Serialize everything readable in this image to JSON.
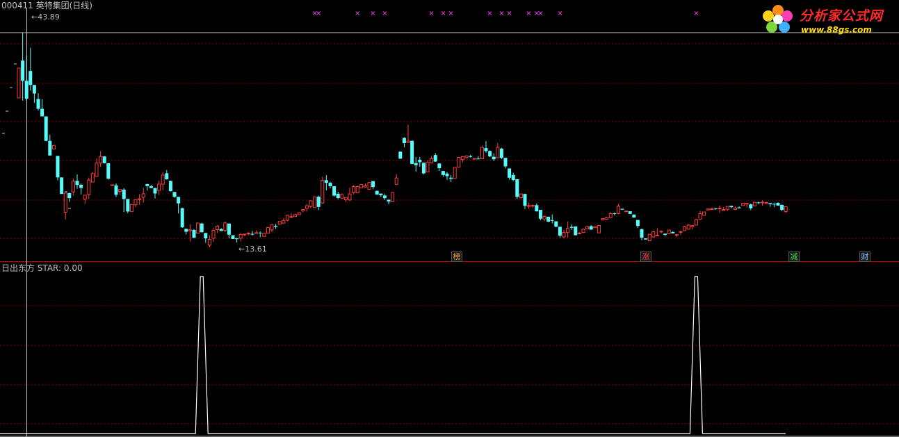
{
  "header": {
    "stock_title": "000411 英特集团(日线)",
    "indicator_title": "日出东方  STAR: 0.00"
  },
  "logo": {
    "name": "分析家公式网",
    "url_text": "www.88gs.com"
  },
  "markers": {
    "high_label": "43.89",
    "low_label": "13.61"
  },
  "badges": [
    {
      "text": "榜",
      "color": "#ffa040"
    },
    {
      "text": "涨",
      "color": "#ff4040"
    },
    {
      "text": "减",
      "color": "#40e040"
    },
    {
      "text": "财",
      "color": "#80c0ff"
    }
  ],
  "colors": {
    "up": "#ff3c3c",
    "down": "#54fcfc",
    "grid": "#8b0000",
    "axis": "#c0c0c0",
    "cross_marker": "#ff40ff",
    "indicator_line": "#ffffff",
    "panel_separator": "#cc0000"
  },
  "chart_data": {
    "type": "candlestick",
    "price_range": [
      13.61,
      43.89
    ],
    "candles": [
      [
        34.68,
        38.9,
        34.68,
        38.9
      ],
      [
        39.95,
        43.89,
        34.3,
        37.1
      ],
      [
        37.1,
        40.7,
        34.3,
        34.58
      ],
      [
        38.48,
        41.77,
        35.72,
        36.51
      ],
      [
        36.51,
        36.51,
        33.99,
        35.31
      ],
      [
        34.53,
        35.37,
        32.9,
        33.15
      ],
      [
        33.15,
        34.5,
        32.08,
        32.08
      ],
      [
        32.08,
        32.08,
        28.56,
        28.63
      ],
      [
        28.63,
        29.5,
        26.54,
        26.56
      ],
      [
        27.47,
        27.99,
        27.47,
        27.99
      ],
      [
        26.5,
        26.5,
        23.06,
        23.47
      ],
      [
        23.47,
        23.47,
        21.14,
        21.14
      ],
      [
        18.56,
        21.27,
        17.54,
        21.27
      ],
      [
        21.25,
        21.34,
        20.01,
        20.56
      ],
      [
        21.43,
        23.33,
        20.94,
        22.94
      ],
      [
        22.99,
        23.89,
        21.87,
        22.41
      ],
      [
        22.43,
        22.6,
        21.09,
        21.98
      ],
      [
        20.4,
        20.97,
        19.74,
        20.97
      ],
      [
        21.06,
        23.45,
        20.44,
        23.1
      ],
      [
        22.82,
        24.23,
        22.82,
        24.01
      ],
      [
        23.61,
        26.15,
        23.61,
        25.49
      ],
      [
        25.49,
        27.18,
        24.96,
        26.43
      ],
      [
        26.43,
        26.5,
        25.43,
        25.48
      ],
      [
        25.48,
        25.48,
        23.16,
        23.29
      ],
      [
        22.43,
        22.43,
        22.43,
        22.43
      ],
      [
        22.35,
        22.63,
        20.7,
        21.02
      ],
      [
        21.49,
        21.77,
        21.02,
        21.77
      ],
      [
        21.75,
        21.95,
        18.58,
        20.43
      ],
      [
        20.43,
        20.43,
        18.43,
        18.67
      ],
      [
        18.67,
        19.73,
        18.67,
        19.66
      ],
      [
        19.62,
        20.38,
        19.28,
        20.34
      ],
      [
        20.34,
        21.12,
        19.61,
        20.46
      ],
      [
        20.66,
        22.02,
        19.91,
        21.16
      ],
      [
        22.53,
        22.59,
        21.62,
        22.25
      ],
      [
        22.25,
        22.39,
        21.96,
        21.98
      ],
      [
        21.98,
        21.98,
        20.49,
        21.21
      ],
      [
        21.64,
        23.02,
        20.99,
        22.52
      ],
      [
        22.52,
        24.2,
        21.64,
        23.81
      ],
      [
        24.06,
        24.51,
        23.16,
        23.2
      ],
      [
        22.99,
        22.99,
        21.48,
        21.53
      ],
      [
        21.42,
        21.42,
        20.61,
        20.72
      ],
      [
        20.72,
        20.72,
        18.4,
        19.81
      ],
      [
        19.13,
        19.21,
        16.37,
        16.43
      ],
      [
        16.22,
        16.22,
        15.44,
        15.81
      ],
      [
        15.95,
        16.86,
        14.43,
        16.07
      ],
      [
        16.07,
        16.16,
        14.94,
        14.96
      ],
      [
        15.59,
        17.13,
        15.59,
        17.03
      ],
      [
        16.97,
        17.08,
        15.73,
        15.73
      ],
      [
        15.63,
        15.63,
        14.24,
        14.87
      ],
      [
        13.92,
        15.31,
        13.61,
        14.74
      ],
      [
        14.89,
        16.34,
        14.36,
        16.0
      ],
      [
        16.1,
        16.73,
        15.63,
        16.6
      ],
      [
        16.18,
        16.32,
        15.91,
        15.91
      ],
      [
        16.01,
        17.23,
        15.76,
        17.05
      ],
      [
        16.97,
        16.97,
        14.88,
        15.4
      ],
      [
        15.32,
        15.32,
        14.79,
        14.79
      ],
      [
        14.89,
        14.93,
        14.28,
        14.76
      ],
      [
        14.89,
        15.62,
        14.45,
        15.43
      ],
      [
        15.43,
        15.51,
        15.15,
        15.48
      ],
      [
        15.61,
        15.75,
        15.32,
        15.61
      ],
      [
        15.52,
        15.93,
        15.28,
        15.41
      ],
      [
        15.68,
        15.99,
        15.63,
        15.68
      ],
      [
        15.68,
        15.82,
        15.04,
        15.66
      ],
      [
        15.16,
        15.67,
        15.16,
        15.58
      ],
      [
        15.59,
        16.47,
        15.58,
        16.39
      ],
      [
        16.06,
        16.81,
        15.74,
        16.78
      ],
      [
        16.59,
        16.92,
        16.21,
        16.45
      ],
      [
        16.87,
        17.26,
        16.79,
        17.26
      ],
      [
        17.03,
        17.71,
        17.0,
        17.4
      ],
      [
        17.43,
        18.15,
        17.29,
        18.15
      ],
      [
        17.88,
        18.43,
        17.73,
        17.95
      ],
      [
        17.95,
        18.35,
        17.94,
        18.22
      ],
      [
        18.22,
        18.55,
        18.22,
        18.51
      ],
      [
        18.74,
        19.0,
        18.56,
        18.95
      ],
      [
        19.12,
        19.73,
        18.65,
        19.48
      ],
      [
        19.37,
        20.23,
        19.13,
        20.18
      ],
      [
        19.21,
        20.78,
        19.17,
        20.73
      ],
      [
        20.75,
        20.89,
        18.86,
        19.31
      ],
      [
        19.86,
        23.58,
        19.73,
        23.07
      ],
      [
        23.08,
        23.79,
        21.65,
        22.71
      ],
      [
        22.72,
        22.85,
        21.95,
        22.22
      ],
      [
        22.22,
        22.22,
        20.75,
        20.9
      ],
      [
        21.17,
        21.45,
        20.38,
        20.56
      ],
      [
        20.55,
        21.23,
        20.5,
        21.05
      ],
      [
        20.35,
        20.65,
        19.99,
        20.65
      ],
      [
        20.29,
        22.05,
        20.11,
        21.15
      ],
      [
        21.32,
        22.42,
        21.1,
        22.18
      ],
      [
        21.29,
        22.3,
        21.29,
        22.18
      ],
      [
        22.01,
        22.49,
        21.96,
        22.49
      ],
      [
        22.13,
        22.61,
        22.03,
        22.28
      ],
      [
        21.8,
        22.82,
        21.76,
        22.74
      ],
      [
        22.95,
        22.95,
        21.8,
        22.12
      ],
      [
        21.58,
        21.58,
        21.02,
        21.06
      ],
      [
        21.2,
        21.2,
        20.71,
        20.96
      ],
      [
        20.92,
        21.13,
        20.28,
        20.54
      ],
      [
        20.33,
        20.33,
        19.66,
        20.08
      ],
      [
        20.05,
        21.36,
        20.05,
        21.34
      ],
      [
        22.5,
        23.92,
        22.41,
        23.4
      ],
      [
        27.11,
        27.11,
        26.11,
        26.11
      ],
      [
        29.05,
        29.14,
        27.72,
        28.31
      ],
      [
        28.39,
        30.92,
        28.39,
        28.59
      ],
      [
        28.64,
        28.64,
        25.34,
        25.38
      ],
      [
        25.48,
        26.34,
        24.28,
        25.18
      ],
      [
        25.97,
        26.37,
        24.97,
        25.62
      ],
      [
        25.55,
        25.55,
        23.93,
        24.03
      ],
      [
        24.26,
        25.92,
        24.26,
        25.58
      ],
      [
        25.5,
        26.52,
        25.5,
        26.13
      ],
      [
        26.63,
        26.9,
        25.66,
        25.71
      ],
      [
        25.44,
        25.44,
        24.38,
        24.77
      ],
      [
        24.38,
        24.41,
        23.57,
        23.81
      ],
      [
        24.02,
        24.23,
        23.1,
        23.65
      ],
      [
        23.44,
        23.8,
        22.82,
        23.27
      ],
      [
        23.34,
        24.92,
        23.27,
        24.89
      ],
      [
        24.94,
        26.31,
        24.93,
        26.3
      ],
      [
        25.98,
        26.42,
        25.62,
        26.42
      ],
      [
        26.26,
        26.6,
        26.13,
        26.5
      ],
      [
        26.5,
        26.62,
        26.26,
        26.38
      ],
      [
        26.1,
        26.14,
        26.05,
        26.14
      ],
      [
        26.13,
        26.48,
        26.02,
        26.09
      ],
      [
        26.1,
        27.93,
        26.09,
        27.7
      ],
      [
        27.61,
        28.6,
        26.94,
        27.19
      ],
      [
        27.2,
        27.27,
        26.35,
        26.43
      ],
      [
        26.39,
        26.88,
        25.79,
        26.02
      ],
      [
        26.24,
        28.33,
        26.24,
        27.73
      ],
      [
        27.54,
        27.64,
        26.07,
        26.23
      ],
      [
        26.23,
        26.23,
        24.74,
        25.03
      ],
      [
        24.74,
        24.74,
        23.13,
        23.43
      ],
      [
        23.82,
        24.13,
        22.95,
        23.11
      ],
      [
        23.22,
        23.22,
        20.45,
        20.72
      ],
      [
        20.61,
        21.23,
        20.48,
        21.14
      ],
      [
        21.14,
        21.14,
        19.02,
        19.46
      ],
      [
        19.45,
        19.95,
        19.03,
        19.49
      ],
      [
        19.53,
        19.66,
        19.16,
        19.53
      ],
      [
        19.55,
        19.79,
        18.68,
        18.68
      ],
      [
        18.9,
        18.9,
        17.43,
        17.65
      ],
      [
        17.61,
        18.12,
        17.3,
        17.96
      ],
      [
        17.93,
        17.93,
        17.15,
        17.24
      ],
      [
        17.45,
        18.24,
        16.99,
        17.44
      ],
      [
        17.28,
        17.28,
        16.46,
        16.51
      ],
      [
        16.51,
        16.51,
        14.95,
        15.25
      ],
      [
        15.08,
        16.1,
        14.91,
        15.7
      ],
      [
        15.7,
        17.22,
        14.98,
        16.27
      ],
      [
        16.51,
        16.86,
        16.07,
        16.37
      ],
      [
        16.55,
        16.55,
        15.28,
        15.32
      ],
      [
        15.61,
        15.78,
        15.49,
        15.61
      ],
      [
        15.71,
        16.25,
        15.69,
        16.15
      ],
      [
        16.2,
        16.66,
        16.2,
        16.52
      ],
      [
        16.59,
        16.75,
        16.08,
        16.12
      ],
      [
        16.39,
        16.54,
        16.32,
        16.54
      ],
      [
        15.64,
        16.69,
        15.62,
        16.69
      ],
      [
        17.5,
        17.68,
        17.4,
        17.67
      ],
      [
        17.59,
        17.88,
        17.55,
        17.81
      ],
      [
        17.79,
        18.62,
        17.78,
        18.36
      ],
      [
        18.41,
        18.53,
        18.12,
        18.39
      ],
      [
        18.39,
        19.73,
        18.26,
        19.41
      ],
      [
        19.05,
        19.05,
        18.89,
        18.92
      ],
      [
        18.72,
        18.76,
        18.68,
        18.73
      ],
      [
        18.7,
        18.71,
        18.32,
        18.32
      ],
      [
        18.23,
        18.26,
        17.79,
        17.81
      ],
      [
        17.47,
        17.47,
        16.33,
        16.63
      ],
      [
        16.17,
        16.24,
        14.6,
        14.97
      ],
      [
        14.87,
        14.87,
        14.71,
        14.71
      ],
      [
        14.54,
        15.47,
        14.54,
        15.46
      ],
      [
        15.07,
        15.97,
        14.97,
        15.8
      ],
      [
        15.31,
        16.31,
        15.24,
        15.35
      ],
      [
        15.78,
        16.0,
        15.57,
        15.88
      ],
      [
        15.54,
        15.54,
        15.21,
        15.38
      ],
      [
        15.53,
        16.09,
        15.44,
        16.06
      ],
      [
        15.77,
        15.91,
        15.55,
        15.58
      ],
      [
        15.37,
        15.49,
        15.08,
        15.4
      ],
      [
        15.83,
        15.93,
        15.34,
        15.83
      ],
      [
        15.97,
        16.63,
        15.93,
        16.52
      ],
      [
        16.17,
        16.89,
        16.15,
        16.76
      ],
      [
        16.51,
        16.79,
        16.14,
        16.71
      ],
      [
        16.75,
        17.64,
        16.74,
        17.52
      ],
      [
        17.6,
        18.76,
        17.48,
        18.36
      ],
      [
        18.12,
        18.6,
        18.12,
        18.6
      ],
      [
        18.88,
        19.06,
        18.87,
        19.02
      ],
      [
        18.94,
        19.2,
        18.94,
        19.07
      ],
      [
        19.07,
        19.18,
        18.94,
        19.05
      ],
      [
        19.09,
        19.53,
        18.45,
        19.14
      ],
      [
        18.79,
        19.31,
        18.74,
        18.94
      ],
      [
        18.97,
        19.38,
        18.7,
        19.38
      ],
      [
        19.46,
        19.51,
        19.11,
        19.28
      ],
      [
        18.95,
        19.37,
        18.87,
        19.16
      ],
      [
        19.24,
        19.38,
        19.08,
        19.11
      ],
      [
        19.51,
        19.84,
        19.48,
        19.82
      ],
      [
        19.76,
        19.85,
        19.2,
        19.81
      ],
      [
        19.66,
        19.78,
        18.85,
        19.12
      ],
      [
        19.46,
        20.01,
        19.39,
        19.97
      ],
      [
        19.95,
        20.05,
        19.67,
        19.86
      ],
      [
        19.88,
        20.22,
        19.48,
        19.98
      ],
      [
        19.89,
        20.06,
        19.83,
        19.92
      ],
      [
        19.85,
        19.88,
        19.32,
        19.71
      ],
      [
        19.75,
        19.82,
        19.28,
        19.69
      ],
      [
        19.88,
        19.98,
        19.49,
        19.5
      ],
      [
        19.6,
        19.64,
        18.68,
        18.89
      ],
      [
        18.66,
        19.39,
        18.46,
        19.34
      ]
    ],
    "cross_signal_indices": [
      76,
      77,
      87,
      91,
      94,
      106,
      109,
      111,
      121,
      124,
      126,
      131,
      133,
      134,
      139,
      174
    ],
    "star_indicator": {
      "name": "STAR",
      "range": [
        0,
        1
      ],
      "spike_indices": [
        47,
        174
      ]
    }
  }
}
